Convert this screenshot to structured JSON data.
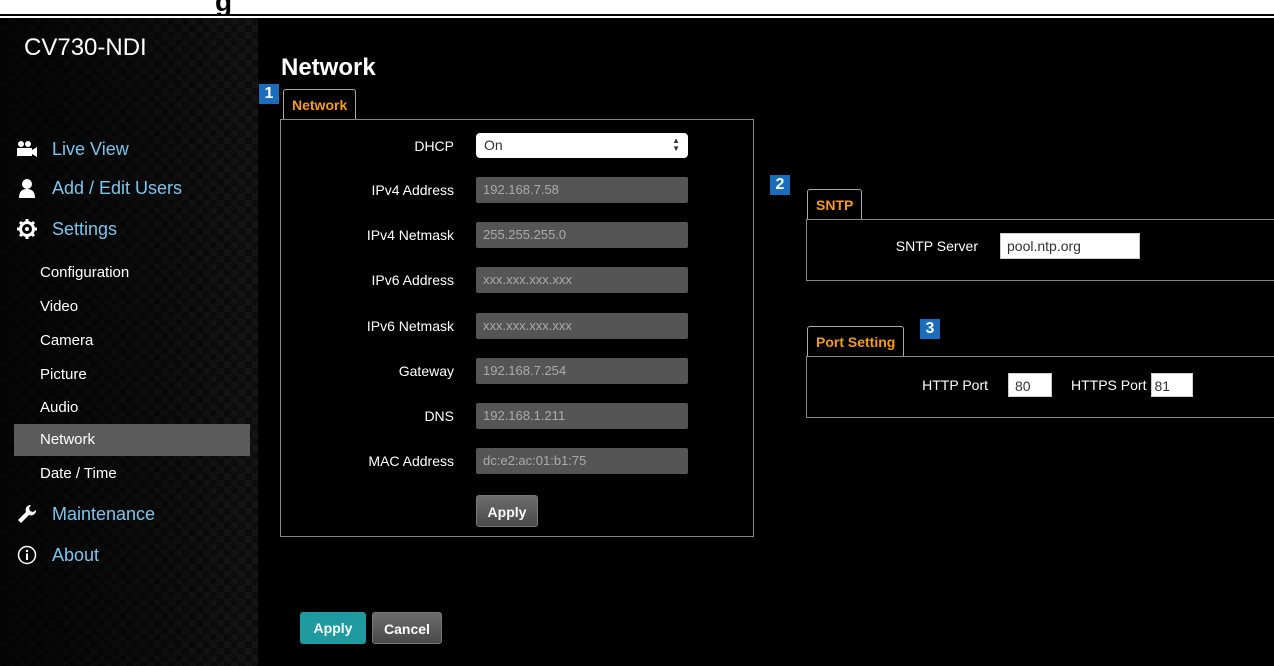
{
  "top_clip": "g",
  "device_name": "CV730-NDI",
  "nav": {
    "live_view": "Live View",
    "users": "Add / Edit Users",
    "settings": "Settings",
    "sub": [
      "Configuration",
      "Video",
      "Camera",
      "Picture",
      "Audio",
      "Network",
      "Date / Time"
    ],
    "maintenance": "Maintenance",
    "about": "About"
  },
  "page_title": "Network",
  "callouts": [
    "1",
    "2",
    "3"
  ],
  "network": {
    "tab": "Network",
    "dhcp_label": "DHCP",
    "dhcp_value": "On",
    "fields": [
      {
        "label": "IPv4 Address",
        "value": "192.168.7.58"
      },
      {
        "label": "IPv4 Netmask",
        "value": "255.255.255.0"
      },
      {
        "label": "IPv6 Address",
        "value": "xxx.xxx.xxx.xxx"
      },
      {
        "label": "IPv6 Netmask",
        "value": "xxx.xxx.xxx.xxx"
      },
      {
        "label": "Gateway",
        "value": "192.168.7.254"
      },
      {
        "label": "DNS",
        "value": "192.168.1.211"
      },
      {
        "label": "MAC Address",
        "value": "dc:e2:ac:01:b1:75"
      }
    ],
    "apply": "Apply"
  },
  "sntp": {
    "tab": "SNTP",
    "server_label": "SNTP Server",
    "server_value": "pool.ntp.org"
  },
  "port": {
    "tab": "Port Setting",
    "http_label": "HTTP Port",
    "http_value": "80",
    "https_label": "HTTPS Port",
    "https_value": "81"
  },
  "footer": {
    "apply": "Apply",
    "cancel": "Cancel"
  },
  "colors": {
    "accent_orange": "#f59b1c",
    "link_blue": "#7cc4ec",
    "callout_blue": "#1a6dbb",
    "apply_teal": "#1f9aa0"
  }
}
